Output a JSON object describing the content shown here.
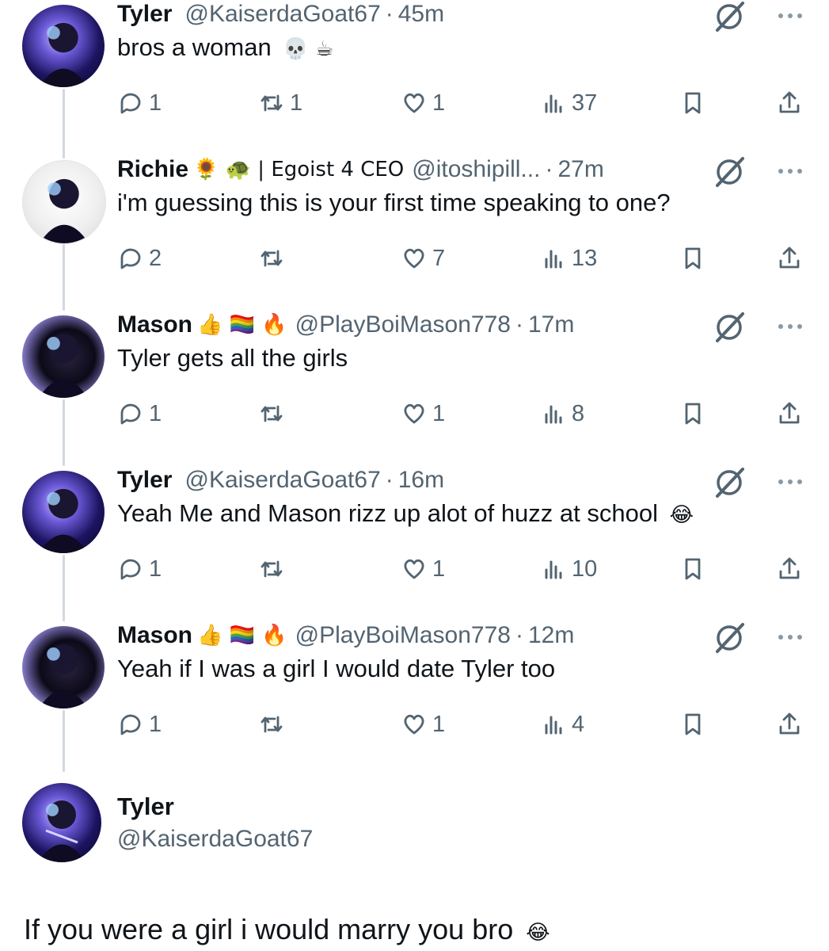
{
  "posts": [
    {
      "name": "Tyler",
      "handle": "@KaiserdaGoat67",
      "time": "45m",
      "badges": "",
      "text": "bros a woman",
      "text_emoji": "💀 ☕",
      "avatar": "tyler",
      "stats": {
        "replies": "1",
        "reposts": "1",
        "likes": "1",
        "views": "37"
      }
    },
    {
      "name": "Richie",
      "badges": "🌻 🐢 | Egoist 4 CEO",
      "handle": "@itoshipill...",
      "time": "27m",
      "text": "i'm guessing this is your first time speaking to one?",
      "text_emoji": "",
      "avatar": "richie",
      "stats": {
        "replies": "2",
        "reposts": "",
        "likes": "7",
        "views": "13"
      }
    },
    {
      "name": "Mason",
      "badges": "👍 🏳️‍🌈 🔥",
      "handle": "@PlayBoiMason778",
      "time": "17m",
      "text": "Tyler gets all the girls",
      "text_emoji": "",
      "avatar": "mason",
      "stats": {
        "replies": "1",
        "reposts": "",
        "likes": "1",
        "views": "8"
      }
    },
    {
      "name": "Tyler",
      "badges": "",
      "handle": "@KaiserdaGoat67",
      "time": "16m",
      "text": "Yeah Me and Mason rizz up alot of huzz at school",
      "text_emoji": "😂",
      "avatar": "tyler",
      "stats": {
        "replies": "1",
        "reposts": "",
        "likes": "1",
        "views": "10"
      }
    },
    {
      "name": "Mason",
      "badges": "👍 🏳️‍🌈 🔥",
      "handle": "@PlayBoiMason778",
      "time": "12m",
      "text": "Yeah if I was a girl I would date Tyler too",
      "text_emoji": "",
      "avatar": "mason",
      "stats": {
        "replies": "1",
        "reposts": "",
        "likes": "1",
        "views": "4"
      }
    }
  ],
  "final_post": {
    "name": "Tyler",
    "handle": "@KaiserdaGoat67",
    "text": "If you were a girl i would marry you bro",
    "text_emoji": "😂"
  },
  "sep": "·",
  "colors": {
    "text": "#0f1419",
    "muted": "#536471",
    "thread_line": "#cfd9de"
  }
}
